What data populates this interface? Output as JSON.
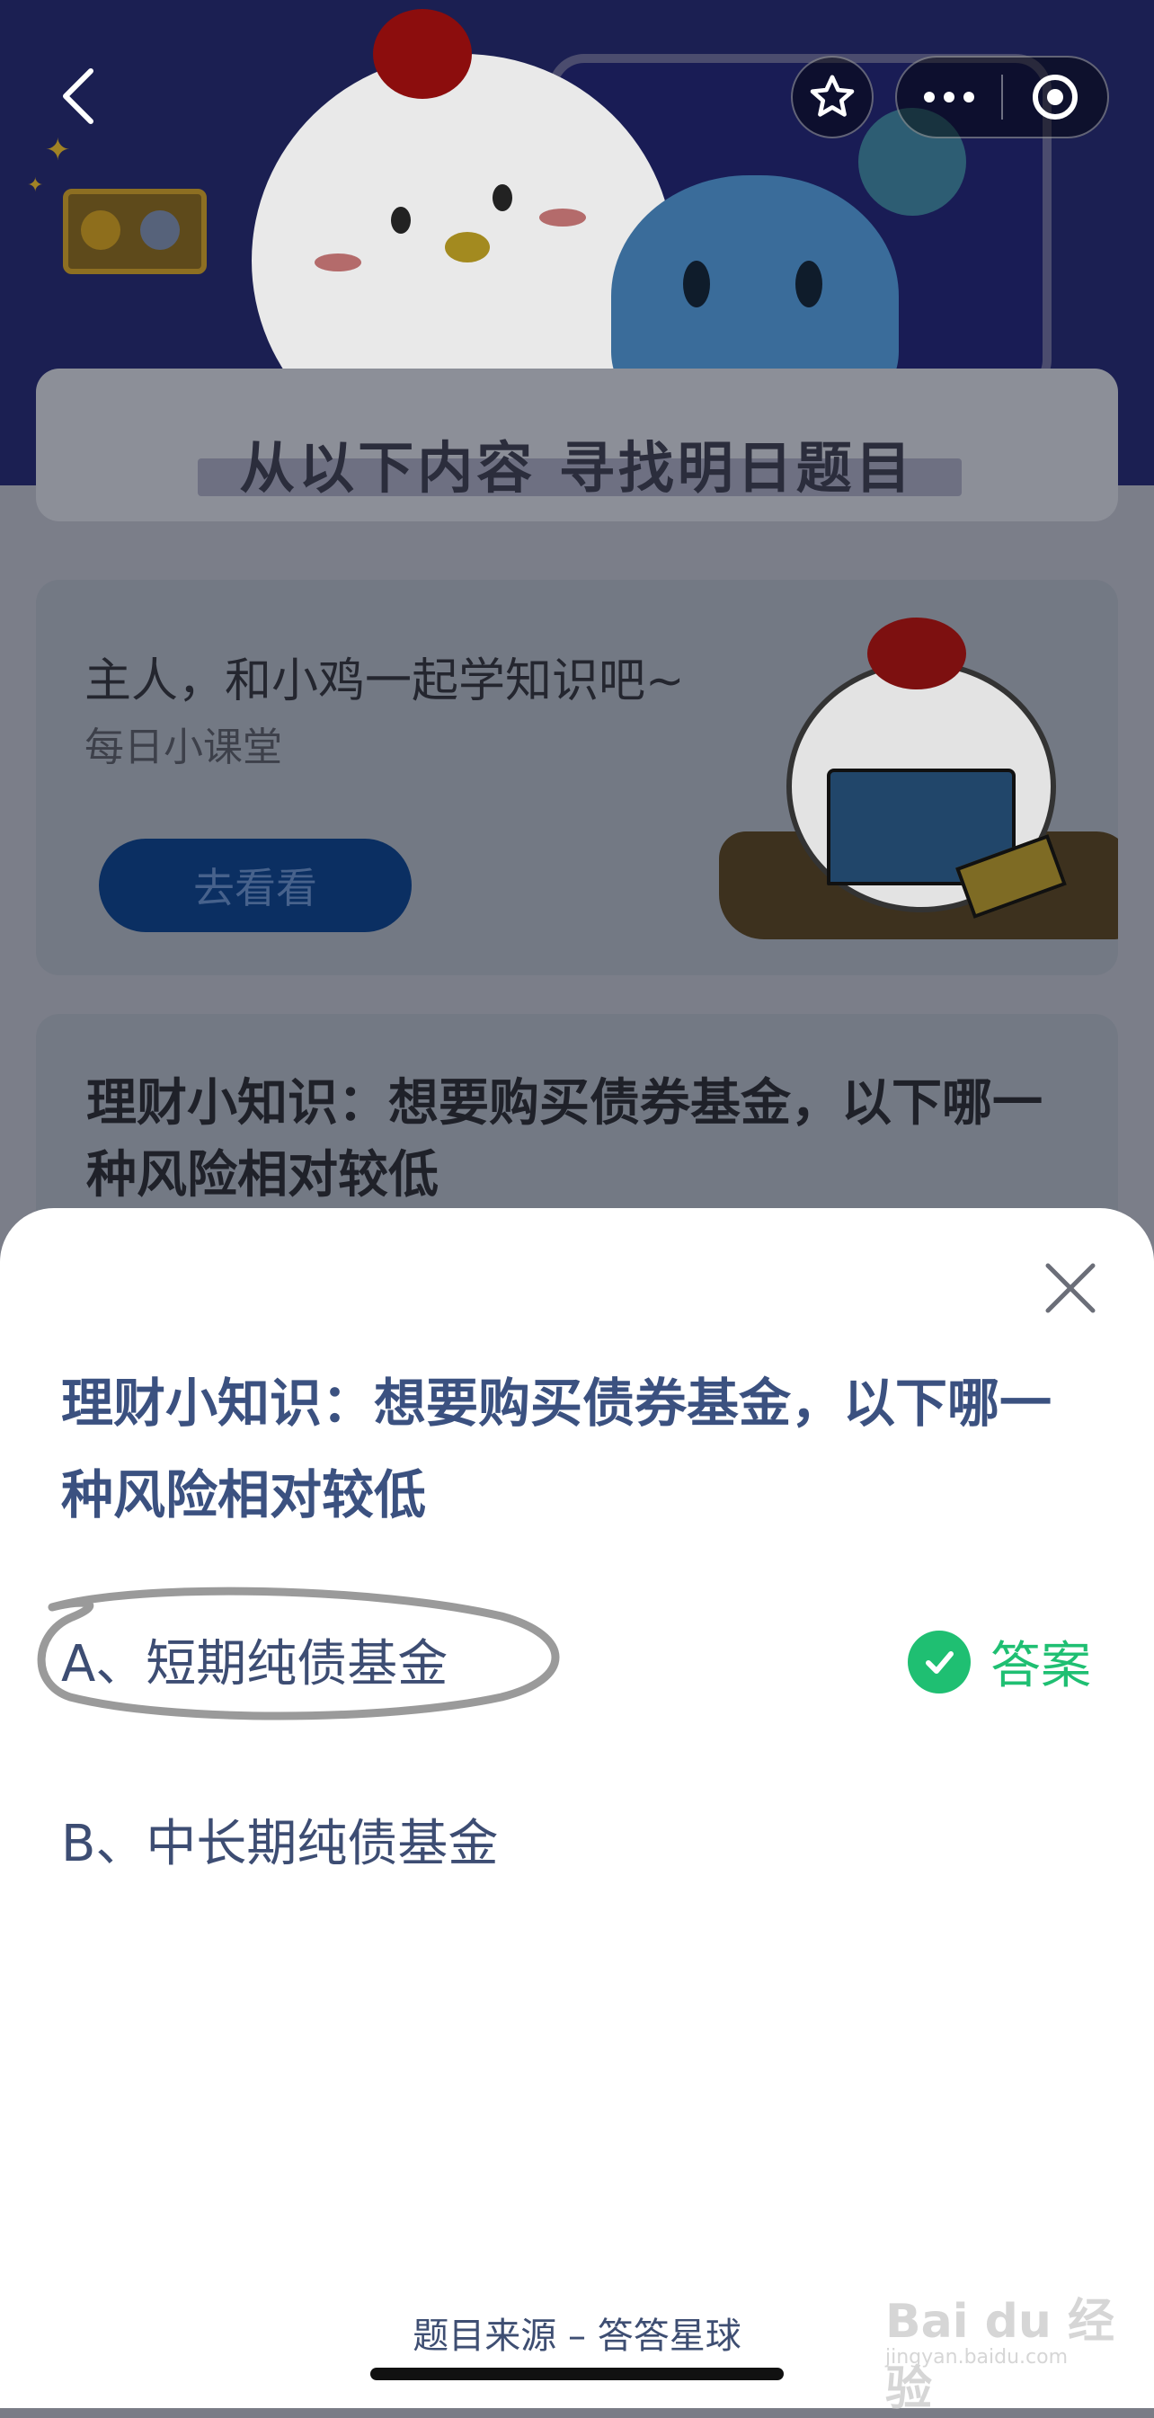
{
  "background": {
    "section_title": "从以下内容 寻找明日题目",
    "lesson_card": {
      "title": "主人，和小鸡一起学知识吧~",
      "subtitle": "每日小课堂",
      "button_label": "去看看"
    },
    "question_card": {
      "title": "理财小知识：想要购买债券基金，以下哪一种风险相对较低"
    }
  },
  "top_bar": {
    "icons": [
      "back-icon",
      "star-icon",
      "more-icon",
      "target-icon"
    ]
  },
  "sheet": {
    "question": "理财小知识：想要购买债券基金，以下哪一种风险相对较低",
    "options": [
      {
        "label": "A、短期纯债基金",
        "is_answer": true
      },
      {
        "label": "B、中长期纯债基金",
        "is_answer": false
      }
    ],
    "answer_tag": "答案",
    "source": "题目来源 – 答答星球"
  },
  "watermark": {
    "text": "Bai du 经验",
    "url": "jingyan.baidu.com"
  },
  "colors": {
    "accent_blue": "#3b5180",
    "answer_green": "#1fbf72",
    "sheet_bg": "#ffffff"
  }
}
